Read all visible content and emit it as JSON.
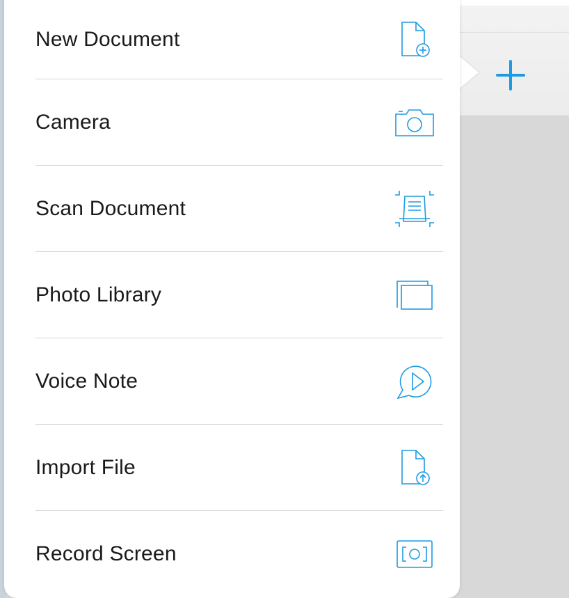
{
  "menu": {
    "items": [
      {
        "label": "New Document",
        "icon": "new-document-icon"
      },
      {
        "label": "Camera",
        "icon": "camera-icon"
      },
      {
        "label": "Scan Document",
        "icon": "scan-document-icon"
      },
      {
        "label": "Photo Library",
        "icon": "photo-library-icon"
      },
      {
        "label": "Voice Note",
        "icon": "voice-note-icon"
      },
      {
        "label": "Import File",
        "icon": "import-file-icon"
      },
      {
        "label": "Record Screen",
        "icon": "record-screen-icon"
      }
    ]
  },
  "toolbar": {
    "add_icon": "plus-icon"
  },
  "colors": {
    "accent": "#1e9be0",
    "text": "#1a1a1a",
    "divider": "#d4d4d4",
    "background": "#d8d8d8"
  }
}
